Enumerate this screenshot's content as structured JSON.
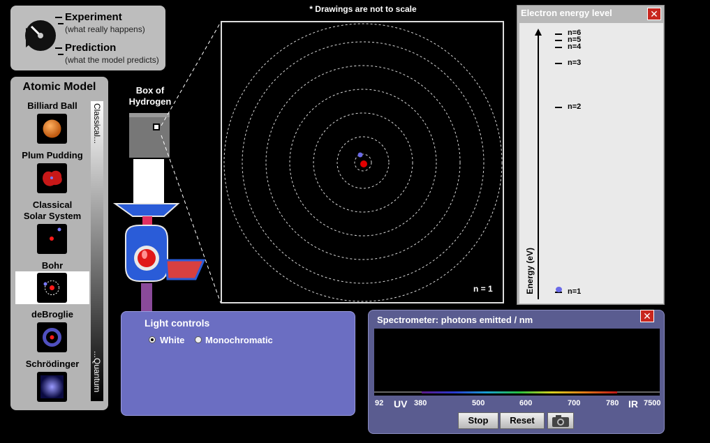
{
  "mode": {
    "experiment_label": "Experiment",
    "experiment_sub": "(what really happens)",
    "prediction_label": "Prediction",
    "prediction_sub": "(what the model predicts)"
  },
  "atomic_model": {
    "title": "Atomic Model",
    "models": [
      {
        "name": "Billiard Ball"
      },
      {
        "name": "Plum Pudding"
      },
      {
        "name": "Classical\nSolar System"
      },
      {
        "name": "Bohr",
        "selected": true
      },
      {
        "name": "deBroglie"
      },
      {
        "name": "Schrödinger"
      }
    ],
    "scale_top": "Classical...",
    "scale_bottom": "...Quantum"
  },
  "box": {
    "label": "Box of\nHydrogen"
  },
  "view": {
    "note": "* Drawings are not to scale",
    "level": "n = 1"
  },
  "energy": {
    "title": "Electron energy level",
    "close": "✕",
    "axis_label": "Energy (eV)",
    "levels": [
      "n=6",
      "n=5",
      "n=4",
      "n=3",
      "n=2",
      "n=1"
    ]
  },
  "light": {
    "title": "Light controls",
    "white_label": "White",
    "mono_label": "Monochromatic",
    "selected": "White"
  },
  "spectrometer": {
    "title": "Spectrometer: photons emitted / nm",
    "close": "✕",
    "ticks": [
      "92",
      "UV",
      "380",
      "500",
      "600",
      "700",
      "780",
      "IR",
      "7500"
    ],
    "stop_label": "Stop",
    "reset_label": "Reset"
  },
  "colors": {
    "panel_gray": "#b4b4b4",
    "light_panel": "#6b6ec2",
    "spec_panel": "#5a5c90",
    "close_red": "#c8261e",
    "electron": "#6a6ae8",
    "nucleus": "#e00000"
  }
}
